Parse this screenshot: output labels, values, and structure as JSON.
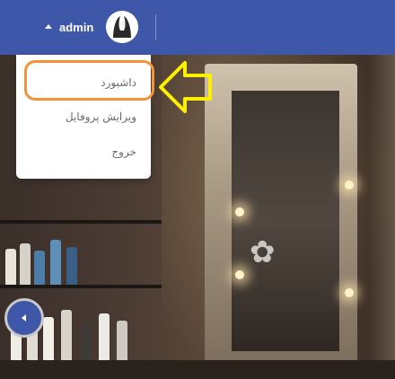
{
  "header": {
    "username": "admin",
    "avatar_icon": "user-avatar-icon",
    "toggle_icon": "caret-up-icon"
  },
  "dropdown": {
    "items": [
      {
        "label": "داشبورد"
      },
      {
        "label": "ویرایش پروفایل"
      },
      {
        "label": "خروج"
      }
    ]
  },
  "annotation": {
    "highlight_color": "#f39237",
    "arrow_color": "#ffef00"
  },
  "sidebar_toggle": {
    "icon": "caret-left-icon"
  },
  "colors": {
    "brand": "#3f57a9"
  }
}
